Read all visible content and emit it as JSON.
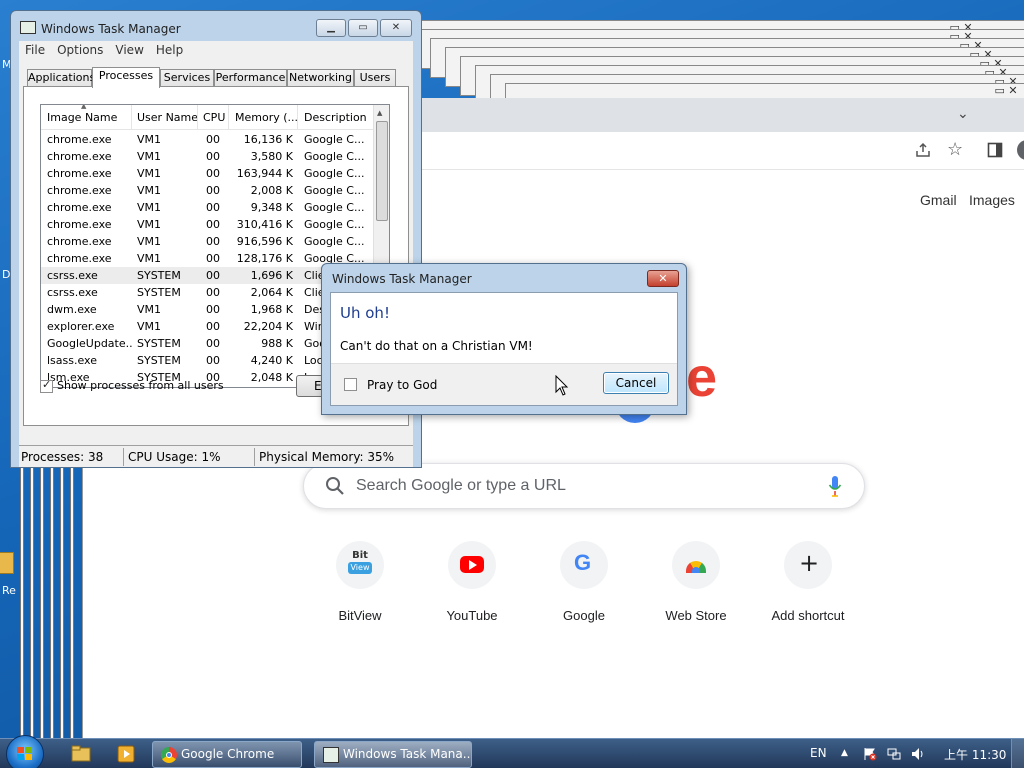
{
  "desktop": {
    "edge_labels": [
      "M",
      "D",
      "Re"
    ]
  },
  "chrome": {
    "taskbar_label": "Google Chrome",
    "toplinks": [
      "Gmail",
      "Images"
    ],
    "search_placeholder": "Search Google or type a URL",
    "shortcuts": [
      {
        "label": "BitView",
        "icon": "bitview-icon"
      },
      {
        "label": "YouTube",
        "icon": "youtube-icon"
      },
      {
        "label": "Google",
        "icon": "google-icon"
      },
      {
        "label": "Web Store",
        "icon": "webstore-icon"
      },
      {
        "label": "Add shortcut",
        "icon": "plus-icon"
      }
    ]
  },
  "task_manager": {
    "title": "Windows Task Manager",
    "menu": [
      "File",
      "Options",
      "View",
      "Help"
    ],
    "tabs": [
      "Applications",
      "Processes",
      "Services",
      "Performance",
      "Networking",
      "Users"
    ],
    "active_tab": "Processes",
    "columns": [
      "Image Name",
      "User Name",
      "CPU",
      "Memory (...",
      "Description"
    ],
    "rows": [
      [
        "chrome.exe",
        "VM1",
        "00",
        "16,136 K",
        "Google C..."
      ],
      [
        "chrome.exe",
        "VM1",
        "00",
        "3,580 K",
        "Google C..."
      ],
      [
        "chrome.exe",
        "VM1",
        "00",
        "163,944 K",
        "Google C..."
      ],
      [
        "chrome.exe",
        "VM1",
        "00",
        "2,008 K",
        "Google C..."
      ],
      [
        "chrome.exe",
        "VM1",
        "00",
        "9,348 K",
        "Google C..."
      ],
      [
        "chrome.exe",
        "VM1",
        "00",
        "310,416 K",
        "Google C..."
      ],
      [
        "chrome.exe",
        "VM1",
        "00",
        "916,596 K",
        "Google C..."
      ],
      [
        "chrome.exe",
        "VM1",
        "00",
        "128,176 K",
        "Google C..."
      ],
      [
        "csrss.exe",
        "SYSTEM",
        "00",
        "1,696 K",
        "Clie"
      ],
      [
        "csrss.exe",
        "SYSTEM",
        "00",
        "2,064 K",
        "Clie"
      ],
      [
        "dwm.exe",
        "VM1",
        "00",
        "1,968 K",
        "Des"
      ],
      [
        "explorer.exe",
        "VM1",
        "00",
        "22,204 K",
        "Win"
      ],
      [
        "GoogleUpdate...",
        "SYSTEM",
        "00",
        "988 K",
        "Goo"
      ],
      [
        "lsass.exe",
        "SYSTEM",
        "00",
        "4,240 K",
        "Loc"
      ],
      [
        "lsm.exe",
        "SYSTEM",
        "00",
        "2,048 K",
        "Loc"
      ]
    ],
    "show_all_label": "Show processes from all users",
    "end_button": "E",
    "status": {
      "processes": "Processes: 38",
      "cpu": "CPU Usage: 1%",
      "memory": "Physical Memory: 35%"
    }
  },
  "dialog": {
    "title": "Windows Task Manager",
    "heading": "Uh oh!",
    "message": "Can't do that on a Christian VM!",
    "checkbox_label": "Pray to God",
    "cancel_label": "Cancel"
  },
  "taskbar": {
    "buttons": [
      {
        "label": "Google Chrome"
      },
      {
        "label": "Windows Task Mana..."
      }
    ],
    "lang": "EN",
    "clock": "上午 11:30"
  }
}
